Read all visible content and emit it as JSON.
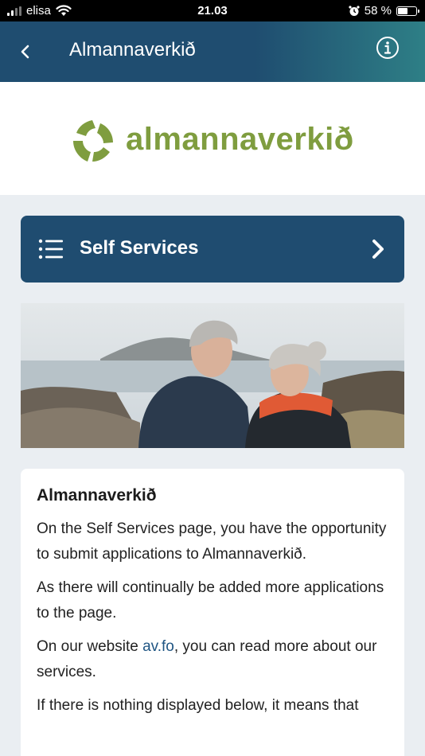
{
  "status_bar": {
    "carrier": "elisa",
    "time": "21.03",
    "battery_percent": "58 %",
    "battery_level": 0.58
  },
  "app_bar": {
    "title": "Almannaverkið",
    "back_icon": "chevron-left-icon",
    "info_icon": "info-circle-icon"
  },
  "logo": {
    "text": "almannaverkið",
    "color": "#7f9d3f"
  },
  "self_services": {
    "label": "Self Services",
    "icon": "list-icon",
    "chevron": "chevron-right-icon",
    "color": "#1f4c70"
  },
  "info": {
    "heading": "Almannaverkið",
    "p1": "On the Self Services page, you have the opportunity to submit applications to Almannaverkið.",
    "p2": "As there will continually be added more applications to the page.",
    "p3_before": "On our website ",
    "p3_link": "av.fo",
    "p3_after": ", you can read more about our services.",
    "p4": "If there is nothing displayed below, it means that"
  }
}
